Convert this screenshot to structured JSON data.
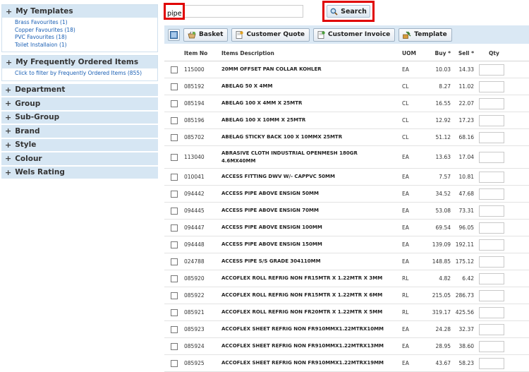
{
  "sidebar": {
    "templates": {
      "title": "My Templates",
      "items": [
        "Brass Favourites (1)",
        "Copper Favourites (18)",
        "PVC Favourites (18)",
        "Toilet Installaion (1)"
      ]
    },
    "frequent": {
      "title": "My Frequently Ordered Items",
      "items": [
        "Click to filter by Frequently Ordered Items (855)"
      ]
    },
    "filters": [
      "Department",
      "Group",
      "Sub-Group",
      "Brand",
      "Style",
      "Colour",
      "Wels Rating"
    ]
  },
  "search": {
    "value": "pipe",
    "button_label": "Search"
  },
  "toolbar": {
    "basket_label": "Basket",
    "quote_label": "Customer Quote",
    "invoice_label": "Customer Invoice",
    "template_label": "Template"
  },
  "table": {
    "headers": {
      "item_no": "Item No",
      "description": "Items Description",
      "uom": "UOM",
      "buy": "Buy *",
      "sell": "Sell *",
      "qty": "Qty"
    },
    "rows": [
      {
        "item": "115000",
        "desc": "20MM OFFSET PAN COLLAR KOHLER",
        "uom": "EA",
        "buy": "10.03",
        "sell": "14.33"
      },
      {
        "item": "085192",
        "desc": "ABELAG 50 X 4MM",
        "uom": "CL",
        "buy": "8.27",
        "sell": "11.02"
      },
      {
        "item": "085194",
        "desc": "ABELAG 100 X 4MM X 25MTR",
        "uom": "CL",
        "buy": "16.55",
        "sell": "22.07"
      },
      {
        "item": "085196",
        "desc": "ABELAG 100 X 10MM X 25MTR",
        "uom": "CL",
        "buy": "12.92",
        "sell": "17.23"
      },
      {
        "item": "085702",
        "desc": "ABELAG STICKY BACK 100 X 10MMX 25MTR",
        "uom": "CL",
        "buy": "51.12",
        "sell": "68.16"
      },
      {
        "item": "113040",
        "desc": "ABRASIVE CLOTH INDUSTRIAL OPENMESH 180GR 4.6MX40MM",
        "uom": "EA",
        "buy": "13.63",
        "sell": "17.04"
      },
      {
        "item": "010041",
        "desc": "ACCESS FITTING DWV W/- CAPPVC 50MM",
        "uom": "EA",
        "buy": "7.57",
        "sell": "10.81"
      },
      {
        "item": "094442",
        "desc": "ACCESS PIPE ABOVE ENSIGN 50MM",
        "uom": "EA",
        "buy": "34.52",
        "sell": "47.68"
      },
      {
        "item": "094445",
        "desc": "ACCESS PIPE ABOVE ENSIGN 70MM",
        "uom": "EA",
        "buy": "53.08",
        "sell": "73.31"
      },
      {
        "item": "094447",
        "desc": "ACCESS PIPE ABOVE ENSIGN 100MM",
        "uom": "EA",
        "buy": "69.54",
        "sell": "96.05"
      },
      {
        "item": "094448",
        "desc": "ACCESS PIPE ABOVE ENSIGN 150MM",
        "uom": "EA",
        "buy": "139.09",
        "sell": "192.11"
      },
      {
        "item": "024788",
        "desc": "ACCESS PIPE S/S GRADE 304110MM",
        "uom": "EA",
        "buy": "148.85",
        "sell": "175.12"
      },
      {
        "item": "085920",
        "desc": "ACCOFLEX ROLL REFRIG NON FR15MTR X 1.22MTR X 3MM",
        "uom": "RL",
        "buy": "4.82",
        "sell": "6.42"
      },
      {
        "item": "085922",
        "desc": "ACCOFLEX ROLL REFRIG NON FR15MTR X 1.22MTR X 6MM",
        "uom": "RL",
        "buy": "215.05",
        "sell": "286.73"
      },
      {
        "item": "085921",
        "desc": "ACCOFLEX ROLL REFRIG NON FR20MTR X 1.22MTR X 5MM",
        "uom": "RL",
        "buy": "319.17",
        "sell": "425.56"
      },
      {
        "item": "085923",
        "desc": "ACCOFLEX SHEET REFRIG NON FR910MMX1.22MTRX10MM",
        "uom": "EA",
        "buy": "24.28",
        "sell": "32.37"
      },
      {
        "item": "085924",
        "desc": "ACCOFLEX SHEET REFRIG NON FR910MMX1.22MTRX13MM",
        "uom": "EA",
        "buy": "28.95",
        "sell": "38.60"
      },
      {
        "item": "085925",
        "desc": "ACCOFLEX SHEET REFRIG NON FR910MMX1.22MTRX19MM",
        "uom": "EA",
        "buy": "43.67",
        "sell": "58.23"
      }
    ]
  },
  "colors": {
    "highlight": "#e00000",
    "panel": "#d6e6f3",
    "link": "#1a5fb4"
  }
}
